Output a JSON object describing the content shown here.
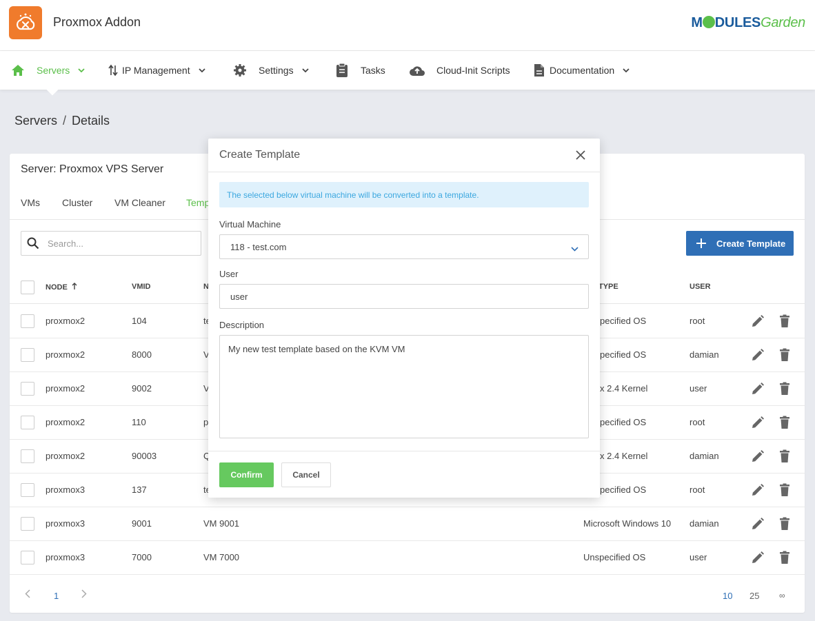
{
  "app": {
    "title": "Proxmox Addon",
    "brand_part1": "M",
    "brand_part2": "DULES",
    "brand_part3": "Garden",
    "logo_icon": "cloud-x-icon"
  },
  "nav": [
    {
      "label": "Servers",
      "icon": "home-icon",
      "active": true
    },
    {
      "label": "IP Management",
      "icon": "sort-arrows-icon"
    },
    {
      "label": "Settings",
      "icon": "gear-icon"
    },
    {
      "label": "Tasks",
      "icon": "clipboard-icon"
    },
    {
      "label": "Cloud-Init Scripts",
      "icon": "cloud-upload-icon"
    },
    {
      "label": "Documentation",
      "icon": "document-icon"
    }
  ],
  "breadcrumb": {
    "root": "Servers",
    "separator": "/",
    "current": "Details"
  },
  "card": {
    "title": "Server: Proxmox VPS Server",
    "tabs": [
      "VMs",
      "Cluster",
      "VM Cleaner",
      "Temp"
    ],
    "search_placeholder": "Search...",
    "create_button": "Create Template"
  },
  "table": {
    "headers": {
      "node": "NODE",
      "vmid": "VMID",
      "name": "N",
      "type": "TYPE",
      "user": "USER"
    },
    "rows": [
      {
        "node": "proxmox2",
        "vmid": "104",
        "name": "te",
        "type": "pecified OS",
        "user": "root"
      },
      {
        "node": "proxmox2",
        "vmid": "8000",
        "name": "V",
        "type": "pecified OS",
        "user": "damian"
      },
      {
        "node": "proxmox2",
        "vmid": "9002",
        "name": "V",
        "type": "x 2.4 Kernel",
        "user": "user"
      },
      {
        "node": "proxmox2",
        "vmid": "110",
        "name": "p",
        "type": "pecified OS",
        "user": "root"
      },
      {
        "node": "proxmox2",
        "vmid": "90003",
        "name": "Q",
        "type": "x 2.4 Kernel",
        "user": "damian"
      },
      {
        "node": "proxmox3",
        "vmid": "137",
        "name": "te",
        "type": "pecified OS",
        "user": "root"
      },
      {
        "node": "proxmox3",
        "vmid": "9001",
        "name": "VM 9001",
        "type": "Microsoft Windows 10",
        "user": "damian"
      },
      {
        "node": "proxmox3",
        "vmid": "7000",
        "name": "VM 7000",
        "type": "Unspecified OS",
        "user": "user"
      }
    ]
  },
  "pager": {
    "current": "1",
    "sizes": [
      "10",
      "25",
      "∞"
    ],
    "active_size": "10"
  },
  "modal": {
    "title": "Create Template",
    "alert": "The selected below virtual machine will be converted into a template.",
    "vm_label": "Virtual Machine",
    "vm_value": "118 - test.com",
    "user_label": "User",
    "user_value": "user",
    "desc_label": "Description",
    "desc_value": "My new test template based on the KVM VM",
    "confirm": "Confirm",
    "cancel": "Cancel"
  },
  "colors": {
    "accent_green": "#5bbf4a",
    "primary_blue": "#2f6fb6",
    "logo_orange": "#f07b2c",
    "alert_bg": "#dff1fc",
    "alert_text": "#3ba7df"
  }
}
